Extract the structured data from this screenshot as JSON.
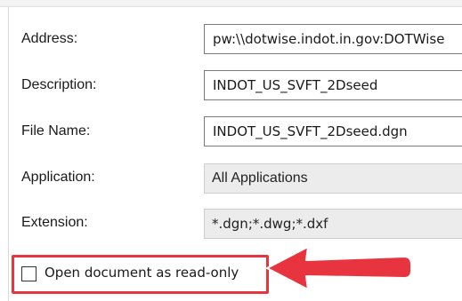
{
  "form": {
    "address": {
      "label": "Address:",
      "value": "pw:\\\\dotwise.indot.in.gov:DOTWise"
    },
    "description": {
      "label": "Description:",
      "value": "INDOT_US_SVFT_2Dseed"
    },
    "file_name": {
      "label": "File Name:",
      "value": "INDOT_US_SVFT_2Dseed.dgn"
    },
    "application": {
      "label": "Application:",
      "value": "All Applications"
    },
    "extension": {
      "label": "Extension:",
      "value": "*.dgn;*.dwg;*.dxf"
    },
    "read_only": {
      "label": "Open document as read-only",
      "checked": false
    }
  },
  "annotation": {
    "highlight_color": "#e8343f",
    "arrow_color": "#e8343f",
    "arrow_icon": "left-arrow-callout"
  }
}
